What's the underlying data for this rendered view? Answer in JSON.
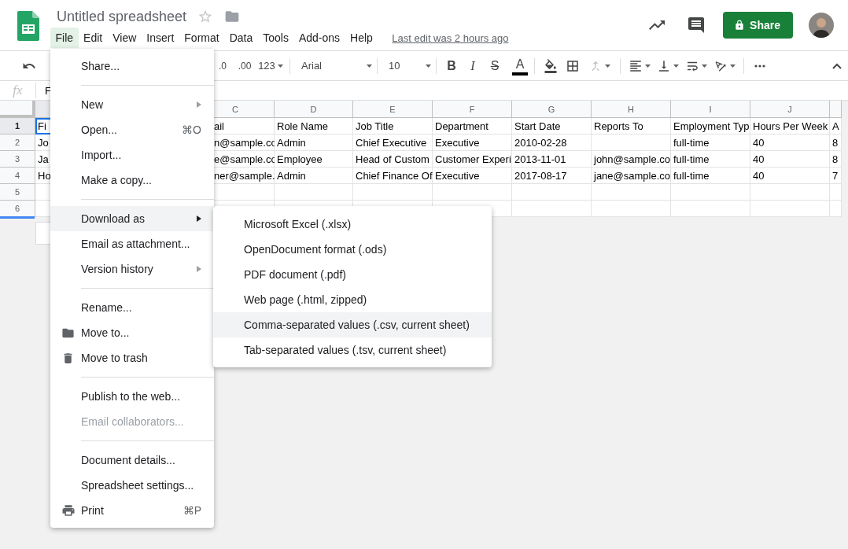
{
  "app": {
    "title": "Untitled spreadsheet",
    "last_edit": "Last edit was 2 hours ago",
    "share_label": "Share"
  },
  "menubar": [
    {
      "label": "File",
      "selected": true
    },
    {
      "label": "Edit",
      "selected": false
    },
    {
      "label": "View",
      "selected": false
    },
    {
      "label": "Insert",
      "selected": false
    },
    {
      "label": "Format",
      "selected": false
    },
    {
      "label": "Data",
      "selected": false
    },
    {
      "label": "Tools",
      "selected": false
    },
    {
      "label": "Add-ons",
      "selected": false
    },
    {
      "label": "Help",
      "selected": false
    }
  ],
  "toolbar": {
    "decimal_decrease": ".0",
    "decimal_increase": ".00",
    "number_format": "123",
    "font": "Arial",
    "font_size": "10",
    "bold": "B",
    "italic": "I",
    "strikethrough": "S",
    "text_color": "A"
  },
  "formula_bar": {
    "fx": "fx",
    "value": "F"
  },
  "sheet": {
    "column_headers": [
      "C",
      "D",
      "E",
      "F",
      "G",
      "H",
      "I",
      "J"
    ],
    "rows": [
      {
        "number": "1",
        "selected": true,
        "cells": [
          "Fi",
          "ail",
          "Role Name",
          "Job Title",
          "Department",
          "Start Date",
          "Reports To",
          "Employment Typ",
          "Hours Per Week",
          "A"
        ]
      },
      {
        "number": "2",
        "selected": false,
        "cells": [
          "Jo",
          "n@sample.co",
          "Admin",
          "Chief Executive",
          "Executive",
          "2010-02-28",
          null,
          "full-time",
          "40",
          "8"
        ]
      },
      {
        "number": "3",
        "selected": false,
        "cells": [
          "Ja",
          "e@sample.co",
          "Employee",
          "Head of Custom",
          "Customer Experi",
          "2013-11-01",
          "john@sample.co",
          "full-time",
          "40",
          "8"
        ]
      },
      {
        "number": "4",
        "selected": false,
        "cells": [
          "Ho",
          "ner@sample.",
          "Admin",
          "Chief Finance Of",
          "Executive",
          "2017-08-17",
          "jane@sample.co",
          "full-time",
          "40",
          "7"
        ]
      },
      {
        "number": "5",
        "selected": false,
        "cells": []
      },
      {
        "number": "6",
        "selected": false,
        "cells": []
      }
    ]
  },
  "file_menu": [
    {
      "kind": "item",
      "label": "Share...",
      "selected": false,
      "disabled": false
    },
    {
      "kind": "divider"
    },
    {
      "kind": "item",
      "label": "New",
      "submenu": true,
      "selected": false,
      "disabled": false
    },
    {
      "kind": "item",
      "label": "Open...",
      "shortcut": "⌘O",
      "selected": false,
      "disabled": false
    },
    {
      "kind": "item",
      "label": "Import...",
      "selected": false,
      "disabled": false
    },
    {
      "kind": "item",
      "label": "Make a copy...",
      "selected": false,
      "disabled": false
    },
    {
      "kind": "divider"
    },
    {
      "kind": "item",
      "label": "Download as",
      "submenu": true,
      "selected": true,
      "disabled": false
    },
    {
      "kind": "item",
      "label": "Email as attachment...",
      "selected": false,
      "disabled": false
    },
    {
      "kind": "item",
      "label": "Version history",
      "submenu": true,
      "selected": false,
      "disabled": false
    },
    {
      "kind": "divider"
    },
    {
      "kind": "item",
      "label": "Rename...",
      "selected": false,
      "disabled": false
    },
    {
      "kind": "folder",
      "label": "Move to...",
      "selected": false,
      "disabled": false
    },
    {
      "kind": "trash",
      "label": "Move to trash",
      "selected": false,
      "disabled": false
    },
    {
      "kind": "divider"
    },
    {
      "kind": "item",
      "label": "Publish to the web...",
      "selected": false,
      "disabled": false
    },
    {
      "kind": "item",
      "label": "Email collaborators...",
      "selected": false,
      "disabled": true
    },
    {
      "kind": "divider"
    },
    {
      "kind": "item",
      "label": "Document details...",
      "selected": false,
      "disabled": false
    },
    {
      "kind": "item",
      "label": "Spreadsheet settings...",
      "selected": false,
      "disabled": false
    },
    {
      "kind": "printer",
      "label": "Print",
      "shortcut": "⌘P",
      "selected": false,
      "disabled": false
    }
  ],
  "download_menu": [
    {
      "label": "Microsoft Excel (.xlsx)",
      "selected": false
    },
    {
      "label": "OpenDocument format (.ods)",
      "selected": false
    },
    {
      "label": "PDF document (.pdf)",
      "selected": false
    },
    {
      "label": "Web page (.html, zipped)",
      "selected": false
    },
    {
      "label": "Comma-separated values (.csv, current sheet)",
      "selected": true
    },
    {
      "label": "Tab-separated values (.tsv, current sheet)",
      "selected": false
    }
  ]
}
